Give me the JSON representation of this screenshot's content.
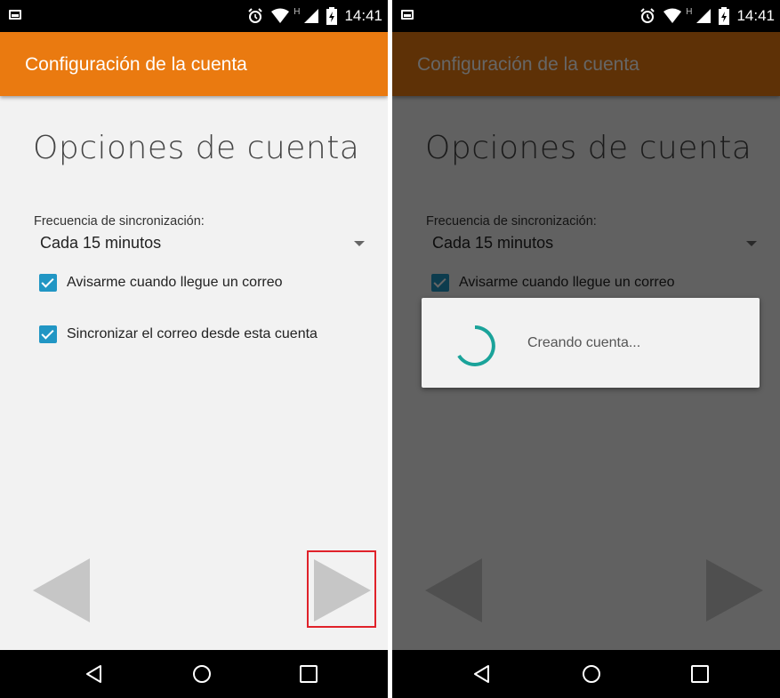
{
  "status_bar": {
    "time": "14:41",
    "network_type": "H",
    "icons": [
      "image-icon",
      "alarm-icon",
      "wifi-icon",
      "signal-icon",
      "battery-charging-icon"
    ]
  },
  "app_bar": {
    "title": "Configuración de la cuenta",
    "color": "#ea7a10"
  },
  "screen": {
    "heading": "Opciones de cuenta",
    "sync_frequency": {
      "label": "Frecuencia de sincronización:",
      "value": "Cada 15 minutos"
    },
    "checkboxes": [
      {
        "label": "Avisarme cuando llegue un correo",
        "checked": true
      },
      {
        "label": "Sincronizar el correo desde esta cuenta",
        "checked": true
      }
    ],
    "navigation": {
      "prev": "previous-arrow-icon",
      "next": "next-arrow-icon"
    }
  },
  "dialog": {
    "message": "Creando cuenta..."
  },
  "nav_bar": {
    "buttons": [
      "back-icon",
      "home-icon",
      "recents-icon"
    ]
  },
  "colors": {
    "accent": "#2196c4",
    "highlight": "#e0222a",
    "spinner": "#1aa39a"
  }
}
